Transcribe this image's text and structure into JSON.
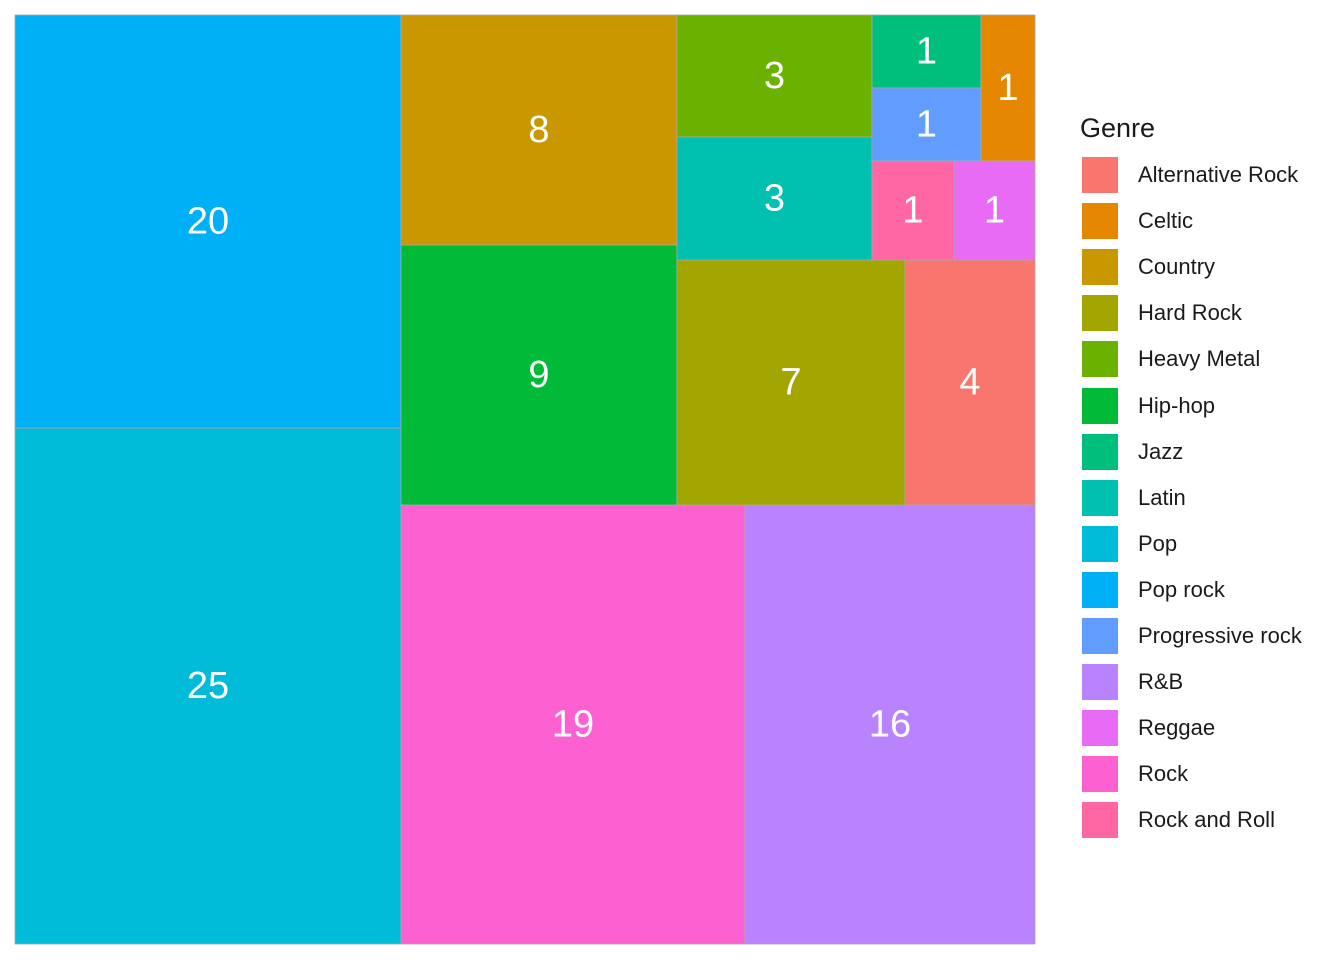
{
  "chart_data": {
    "type": "treemap",
    "legend_title": "Genre",
    "legend_position": "right",
    "genres": [
      {
        "name": "Alternative Rock",
        "color": "#F8766D"
      },
      {
        "name": "Celtic",
        "color": "#E58700"
      },
      {
        "name": "Country",
        "color": "#C99800"
      },
      {
        "name": "Hard Rock",
        "color": "#A3A500"
      },
      {
        "name": "Heavy Metal",
        "color": "#6BB100"
      },
      {
        "name": "Hip-hop",
        "color": "#00BA38"
      },
      {
        "name": "Jazz",
        "color": "#00BF7D"
      },
      {
        "name": "Latin",
        "color": "#00C0AF"
      },
      {
        "name": "Pop",
        "color": "#00BCD8"
      },
      {
        "name": "Pop rock",
        "color": "#00B0F6"
      },
      {
        "name": "Progressive rock",
        "color": "#619CFF"
      },
      {
        "name": "R&B",
        "color": "#B983FF"
      },
      {
        "name": "Reggae",
        "color": "#E76BF3"
      },
      {
        "name": "Rock",
        "color": "#FD61D1"
      },
      {
        "name": "Rock and Roll",
        "color": "#FF67A4"
      }
    ],
    "tiles": [
      {
        "genre": "Pop",
        "value": 25
      },
      {
        "genre": "Pop rock",
        "value": 20
      },
      {
        "genre": "Rock",
        "value": 19
      },
      {
        "genre": "R&B",
        "value": 16
      },
      {
        "genre": "Hip-hop",
        "value": 9
      },
      {
        "genre": "Country",
        "value": 8
      },
      {
        "genre": "Hard Rock",
        "value": 7
      },
      {
        "genre": "Alternative Rock",
        "value": 4
      },
      {
        "genre": "Heavy Metal",
        "value": 3
      },
      {
        "genre": "Latin",
        "value": 3
      },
      {
        "genre": "Jazz",
        "value": 1
      },
      {
        "genre": "Progressive rock",
        "value": 1
      },
      {
        "genre": "Celtic",
        "value": 1
      },
      {
        "genre": "Rock and Roll",
        "value": 1
      },
      {
        "genre": "Reggae",
        "value": 1
      }
    ]
  }
}
